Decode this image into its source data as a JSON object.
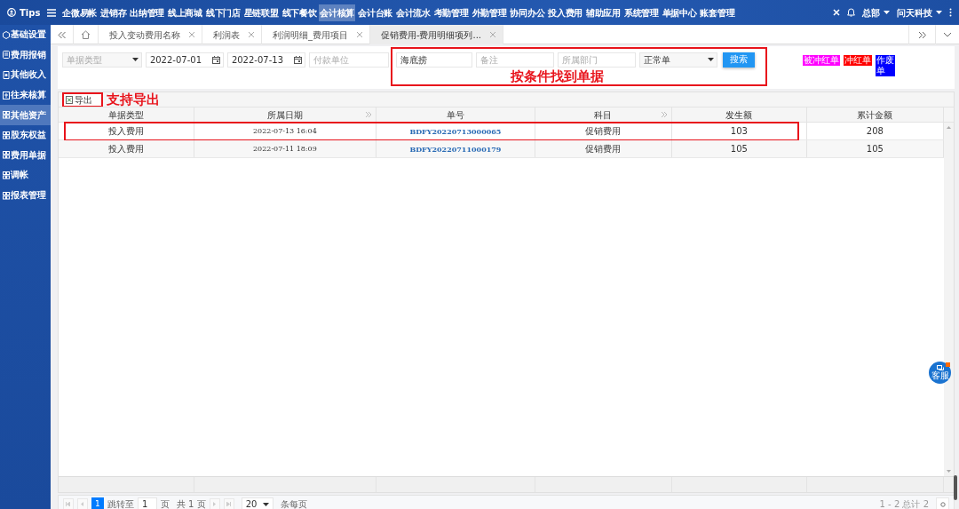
{
  "topbar": {
    "brand": "Tips",
    "nav": [
      {
        "label": "企微易帐",
        "selected": false
      },
      {
        "label": "进销存",
        "selected": false
      },
      {
        "label": "出纳管理",
        "selected": false
      },
      {
        "label": "线上商城",
        "selected": false
      },
      {
        "label": "线下门店",
        "selected": false
      },
      {
        "label": "星链联盟",
        "selected": false
      },
      {
        "label": "线下餐饮",
        "selected": false
      },
      {
        "label": "会计核算",
        "selected": true
      },
      {
        "label": "会计台账",
        "selected": false
      },
      {
        "label": "会计流水",
        "selected": false
      },
      {
        "label": "考勤管理",
        "selected": false
      },
      {
        "label": "外勤管理",
        "selected": false
      },
      {
        "label": "协同办公",
        "selected": false
      },
      {
        "label": "投入费用",
        "selected": false
      },
      {
        "label": "辅助应用",
        "selected": false
      },
      {
        "label": "系统管理",
        "selected": false
      },
      {
        "label": "单据中心",
        "selected": false
      },
      {
        "label": "账套管理",
        "selected": false
      }
    ],
    "org": "总部",
    "company": "问天科技"
  },
  "sidebar": {
    "items": [
      {
        "label": "基础设置",
        "selected": false
      },
      {
        "label": "费用报销",
        "selected": false
      },
      {
        "label": "其他收入",
        "selected": false
      },
      {
        "label": "往来核算",
        "selected": false
      },
      {
        "label": "其他资产",
        "selected": true
      },
      {
        "label": "股东权益",
        "selected": false
      },
      {
        "label": "费用单据",
        "selected": false
      },
      {
        "label": "调帐",
        "selected": false
      },
      {
        "label": "报表管理",
        "selected": false
      }
    ]
  },
  "tabs": [
    {
      "label": "投入变动费用名称",
      "selected": false
    },
    {
      "label": "利润表",
      "selected": false
    },
    {
      "label": "利润明细_费用项目",
      "selected": false
    },
    {
      "label": "促销费用-费用明细项列...",
      "selected": true
    }
  ],
  "filters": [
    {
      "kind": "select",
      "placeholder": "单据类型"
    },
    {
      "kind": "date",
      "value": "2022-07-01"
    },
    {
      "kind": "date",
      "value": "2022-07-13"
    },
    {
      "kind": "text",
      "placeholder": "付款单位"
    }
  ],
  "search_filters": [
    {
      "kind": "text",
      "value": "海底捞"
    },
    {
      "kind": "text",
      "placeholder": "备注"
    },
    {
      "kind": "text",
      "placeholder": "所属部门"
    },
    {
      "kind": "select",
      "value": "正常单"
    }
  ],
  "search_button": "搜索",
  "search_note": "按条件找到单据",
  "legend": [
    {
      "label": "被冲红单",
      "color": "#ff00ff"
    },
    {
      "label": "冲红单",
      "color": "#ff0000"
    },
    {
      "label": "作废单",
      "color": "#0000ff"
    }
  ],
  "export_button": "导出",
  "export_note": "支持导出",
  "table": {
    "columns": [
      "单据类型",
      "所属日期",
      "单号",
      "科目",
      "发生额",
      "累计金额"
    ],
    "rows": [
      {
        "cells": [
          "投入费用",
          "2022-07-13 16:04",
          "BDFY20220713000065",
          "促销费用",
          "103",
          "208"
        ],
        "annotated": true
      },
      {
        "cells": [
          "投入费用",
          "2022-07-11 18:09",
          "BDFY20220711000179",
          "促销费用",
          "105",
          "105"
        ],
        "annotated": false
      }
    ]
  },
  "pager": {
    "page": "1",
    "jump_label": "跳转至",
    "jump_value": "1",
    "page_unit": "页",
    "total_pages": "共 1 页",
    "page_size": "20",
    "page_size_label": "条每页",
    "summary": "1 - 2 总计 2"
  },
  "chat_button": "客服"
}
